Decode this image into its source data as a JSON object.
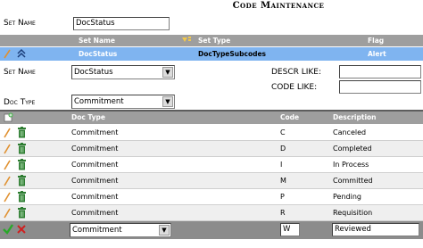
{
  "title": "Code Maintenance",
  "set_name_field": {
    "label": "Set Name",
    "value": "DocStatus"
  },
  "set_grid": {
    "headers": {
      "set_name": "Set Name",
      "set_type": "Set Type",
      "flag": "Flag"
    },
    "selected_row": {
      "set_name": "DocStatus",
      "set_type": "DocTypeSubcodes",
      "flag": "Alert"
    }
  },
  "filters": {
    "set_name_label": "Set Name",
    "set_name_value": "DocStatus",
    "doc_type_label": "Doc Type",
    "doc_type_value": "Commitment",
    "descr_like_label": "DESCR LIKE:",
    "descr_like_value": "",
    "code_like_label": "CODE LIKE:",
    "code_like_value": ""
  },
  "code_grid": {
    "headers": {
      "doc_type": "Doc Type",
      "code": "Code",
      "description": "Description"
    },
    "rows": [
      {
        "doc_type": "Commitment",
        "code": "C",
        "description": "Canceled"
      },
      {
        "doc_type": "Commitment",
        "code": "D",
        "description": "Completed"
      },
      {
        "doc_type": "Commitment",
        "code": "I",
        "description": "In Process"
      },
      {
        "doc_type": "Commitment",
        "code": "M",
        "description": "Committed"
      },
      {
        "doc_type": "Commitment",
        "code": "P",
        "description": "Pending"
      },
      {
        "doc_type": "Commitment",
        "code": "R",
        "description": "Requisition"
      }
    ],
    "edit_row": {
      "doc_type": "Commitment",
      "code": "W",
      "description": "Reviewed"
    }
  },
  "icons": {
    "edit": "pencil-icon",
    "delete": "trash-icon",
    "save": "checkmark-icon",
    "cancel": "x-icon",
    "add": "add-icon",
    "collapse": "double-chevron-up-icon",
    "sort": "sort-icon"
  },
  "colors": {
    "header_gray": "#9e9e9e",
    "selected_blue": "#7fb4f0",
    "alt_row": "#efefef",
    "trash_green": "#2e7d32",
    "pencil_orange": "#e09030",
    "check_green": "#2aa82a",
    "cancel_red": "#d02020"
  }
}
